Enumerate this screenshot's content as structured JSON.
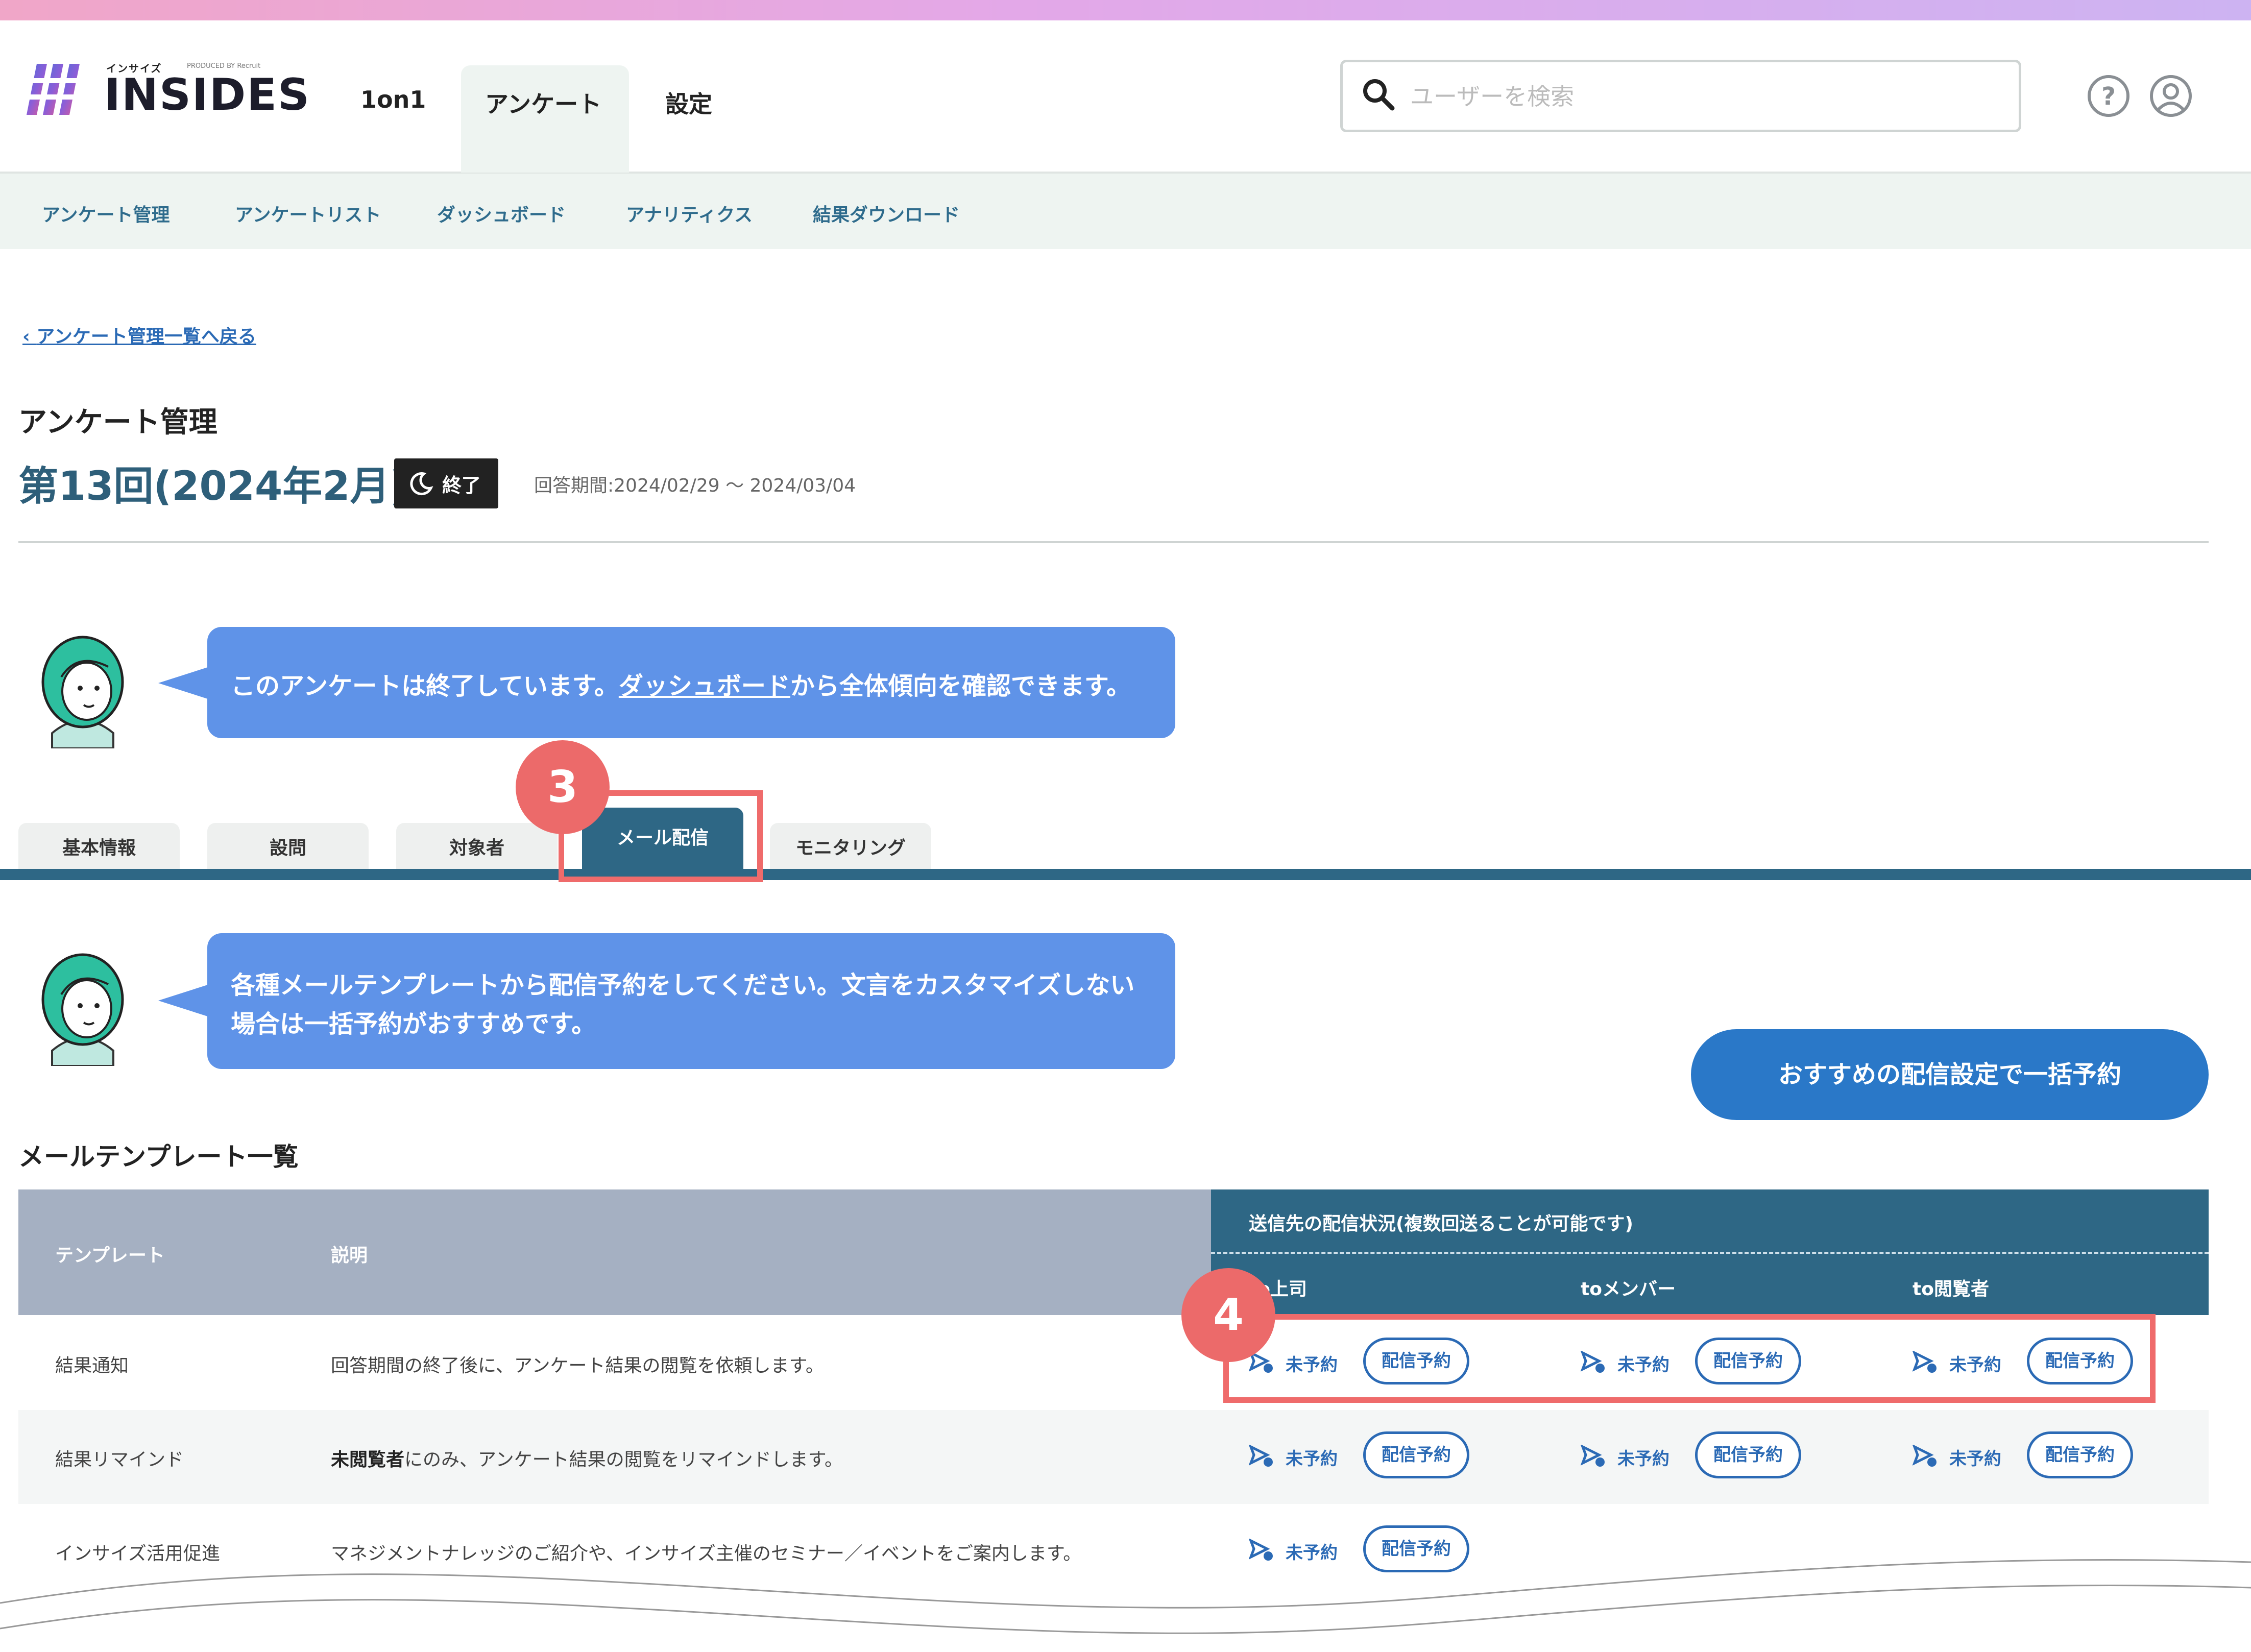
{
  "brand": {
    "kana": "インサイズ",
    "name": "INSIDES",
    "produced_by": "PRODUCED BY Recruit"
  },
  "global_nav": {
    "items": [
      "1on1",
      "アンケート",
      "設定"
    ],
    "active": "アンケート"
  },
  "search": {
    "placeholder": "ユーザーを検索",
    "value": ""
  },
  "subnav": {
    "items": [
      "アンケート管理",
      "アンケートリスト",
      "ダッシュボード",
      "アナリティクス",
      "結果ダウンロード"
    ]
  },
  "back_link": "アンケート管理一覧へ戻る",
  "page_title": "アンケート管理",
  "survey": {
    "name": "第13回(2024年2月)",
    "status": "終了",
    "period": "回答期間:2024/02/29 ～ 2024/03/04"
  },
  "message1": {
    "before": "このアンケートは終了しています。",
    "link": "ダッシュボード",
    "after": "から全体傾向を確認できます。"
  },
  "tabs": [
    "基本情報",
    "設問",
    "対象者",
    "メール配信",
    "モニタリング"
  ],
  "active_tab": "メール配信",
  "message2": {
    "line1": "各種メールテンプレートから配信予約をしてください。文言をカスタマイズしない",
    "line2": "場合は一括予約がおすすめです。"
  },
  "bulk_button": "おすすめの配信設定で一括予約",
  "list_title": "メールテンプレート一覧",
  "table": {
    "col_template": "テンプレート",
    "col_description": "説明",
    "col_status_group": "送信先の配信状況(複数回送ることが可能です)",
    "recipients": [
      "to上司",
      "toメンバー",
      "to閲覧者"
    ],
    "status_label": "未予約",
    "button_label": "配信予約",
    "rows": [
      {
        "template": "結果通知",
        "description": "回答期間の終了後に、アンケート結果の閲覧を依頼します。"
      },
      {
        "template": "結果リマインド",
        "description_bold": "未閲覧者",
        "description": "にのみ、アンケート結果の閲覧をリマインドします。"
      },
      {
        "template": "インサイズ活用促進",
        "description": "マネジメントナレッジのご紹介や、インサイズ主催のセミナー／イベントをご案内します。"
      }
    ]
  },
  "annotations": {
    "step3": "3",
    "step4": "4"
  },
  "colors": {
    "accent": "#2e6785",
    "bubble": "#5f93e8",
    "button": "#2a78c8",
    "highlight": "#ef6b6b"
  }
}
